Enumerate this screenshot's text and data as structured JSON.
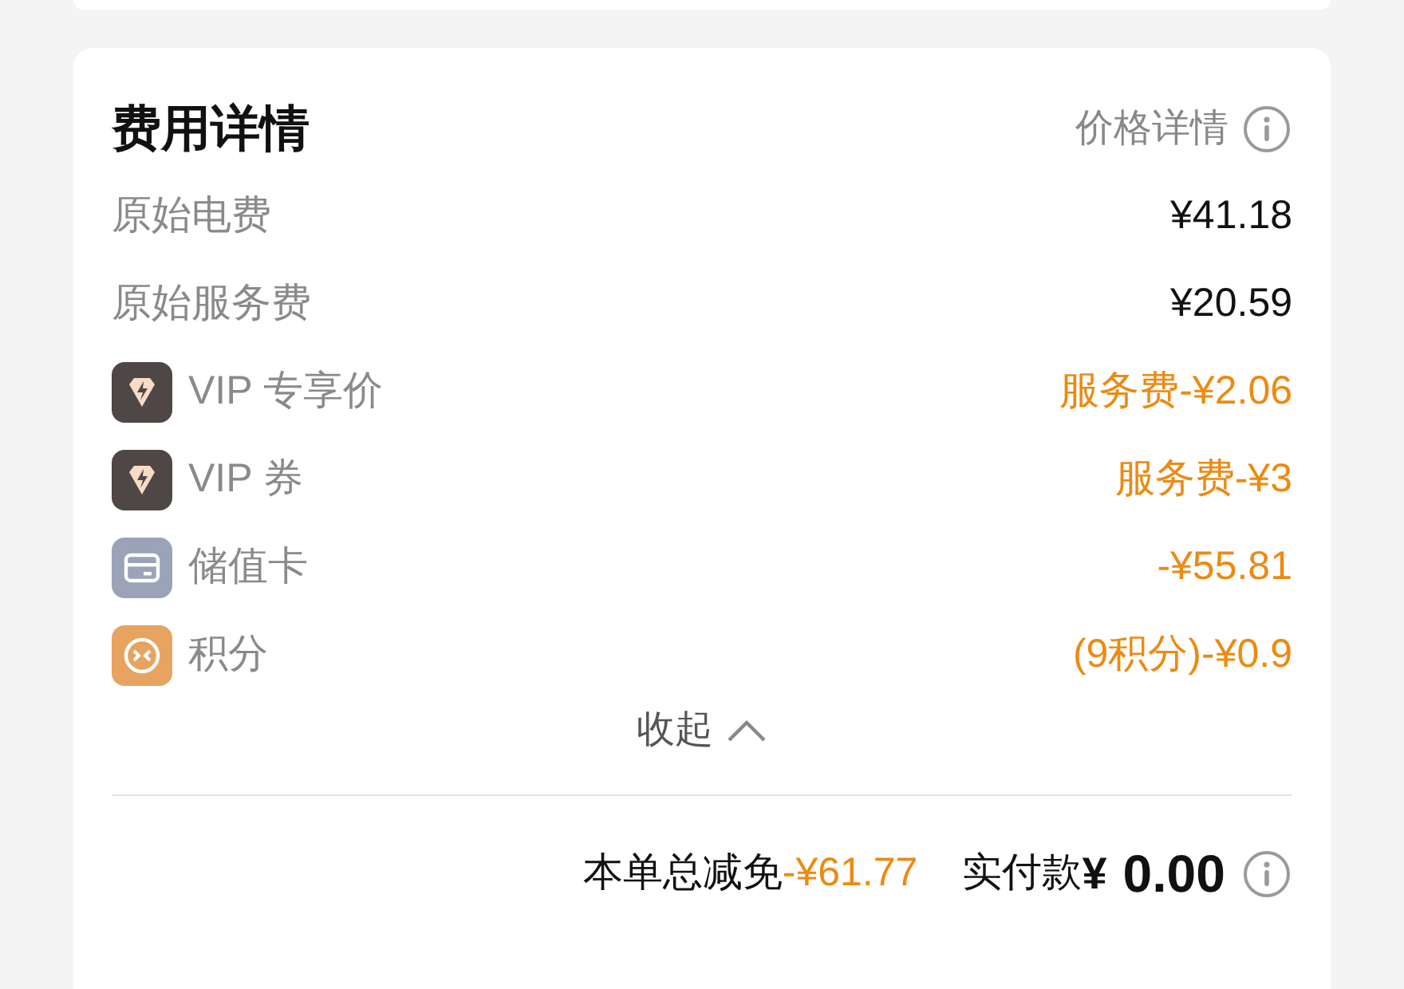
{
  "title": "费用详情",
  "price_detail_link": "价格详情",
  "rows": [
    {
      "kind": "plain",
      "label": "原始电费",
      "value": "¥41.18",
      "discount": false
    },
    {
      "kind": "plain",
      "label": "原始服务费",
      "value": "¥20.59",
      "discount": false
    },
    {
      "kind": "vip",
      "label": "VIP 专享价",
      "value": "服务费-¥2.06",
      "discount": true
    },
    {
      "kind": "vip",
      "label": "VIP 券",
      "value": "服务费-¥3",
      "discount": true
    },
    {
      "kind": "card",
      "label": "储值卡",
      "value": "-¥55.81",
      "discount": true
    },
    {
      "kind": "points",
      "label": "积分",
      "value": "(9积分)-¥0.9",
      "discount": true
    }
  ],
  "collapse": {
    "label": "收起",
    "expanded": true
  },
  "footer": {
    "reduction_label": "本单总减免",
    "reduction_value": "-¥61.77",
    "paid_label": "实付款",
    "currency": "¥",
    "paid_value": "0.00"
  }
}
